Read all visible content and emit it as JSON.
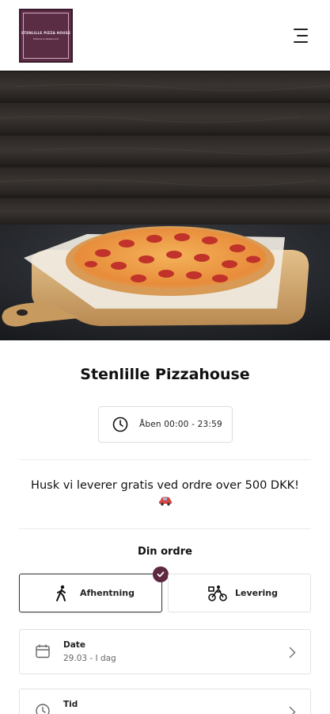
{
  "header": {
    "logo_title": "STENLILLE PIZZA HOUSE",
    "logo_subtitle": "Pizzeria & Restaurant"
  },
  "restaurant": {
    "name": "Stenlille Pizzahouse",
    "hours": "Åben 00:00 - 23:59"
  },
  "notice": {
    "text": "Husk vi leverer gratis ved ordre over 500 DKK!"
  },
  "order": {
    "title": "Din ordre",
    "options": [
      {
        "label": "Afhentning",
        "icon": "walking-person-icon",
        "selected": true
      },
      {
        "label": "Levering",
        "icon": "delivery-bike-icon",
        "selected": false
      }
    ],
    "date": {
      "title": "Date",
      "value": "29.03 - I dag",
      "icon": "calendar-icon"
    },
    "time": {
      "title": "Tid",
      "icon": "clock-icon"
    }
  },
  "colors": {
    "brand": "#5e2940",
    "border": "#e2e2e2",
    "text": "#111111"
  }
}
